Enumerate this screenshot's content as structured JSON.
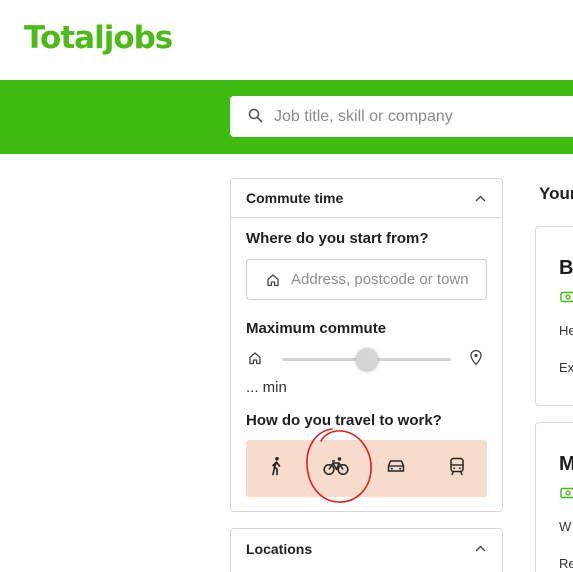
{
  "header": {
    "logo_text": "Totaljobs"
  },
  "search": {
    "placeholder": "Job title, skill or company",
    "icon": "search-icon"
  },
  "commute_panel": {
    "title": "Commute time",
    "start_question": "Where do you start from?",
    "address_placeholder": "Address, postcode or town",
    "max_commute_label": "Maximum commute",
    "minutes_text": "... min",
    "slider_level_percent": 50,
    "travel_question": "How do you travel to work?",
    "travel_modes": [
      {
        "name": "walking",
        "icon": "walking-icon",
        "selected": false
      },
      {
        "name": "cycling",
        "icon": "bicycle-icon",
        "selected": true
      },
      {
        "name": "driving",
        "icon": "car-icon",
        "selected": false
      },
      {
        "name": "public transport",
        "icon": "train-icon",
        "selected": false
      }
    ]
  },
  "locations_panel": {
    "title": "Locations"
  },
  "results": {
    "heading_fragment": "Your",
    "cards": [
      {
        "title_fragment": "B",
        "line1_fragment": "He",
        "line2_fragment": "Ex"
      },
      {
        "title_fragment": "M",
        "line1_fragment": "W",
        "line2_fragment": "Re"
      }
    ]
  },
  "colors": {
    "brand_green": "#3cbd0f",
    "logo_green": "#4cbb17",
    "travel_mode_background": "#f7dccc",
    "annotation_red": "#e0211f"
  }
}
